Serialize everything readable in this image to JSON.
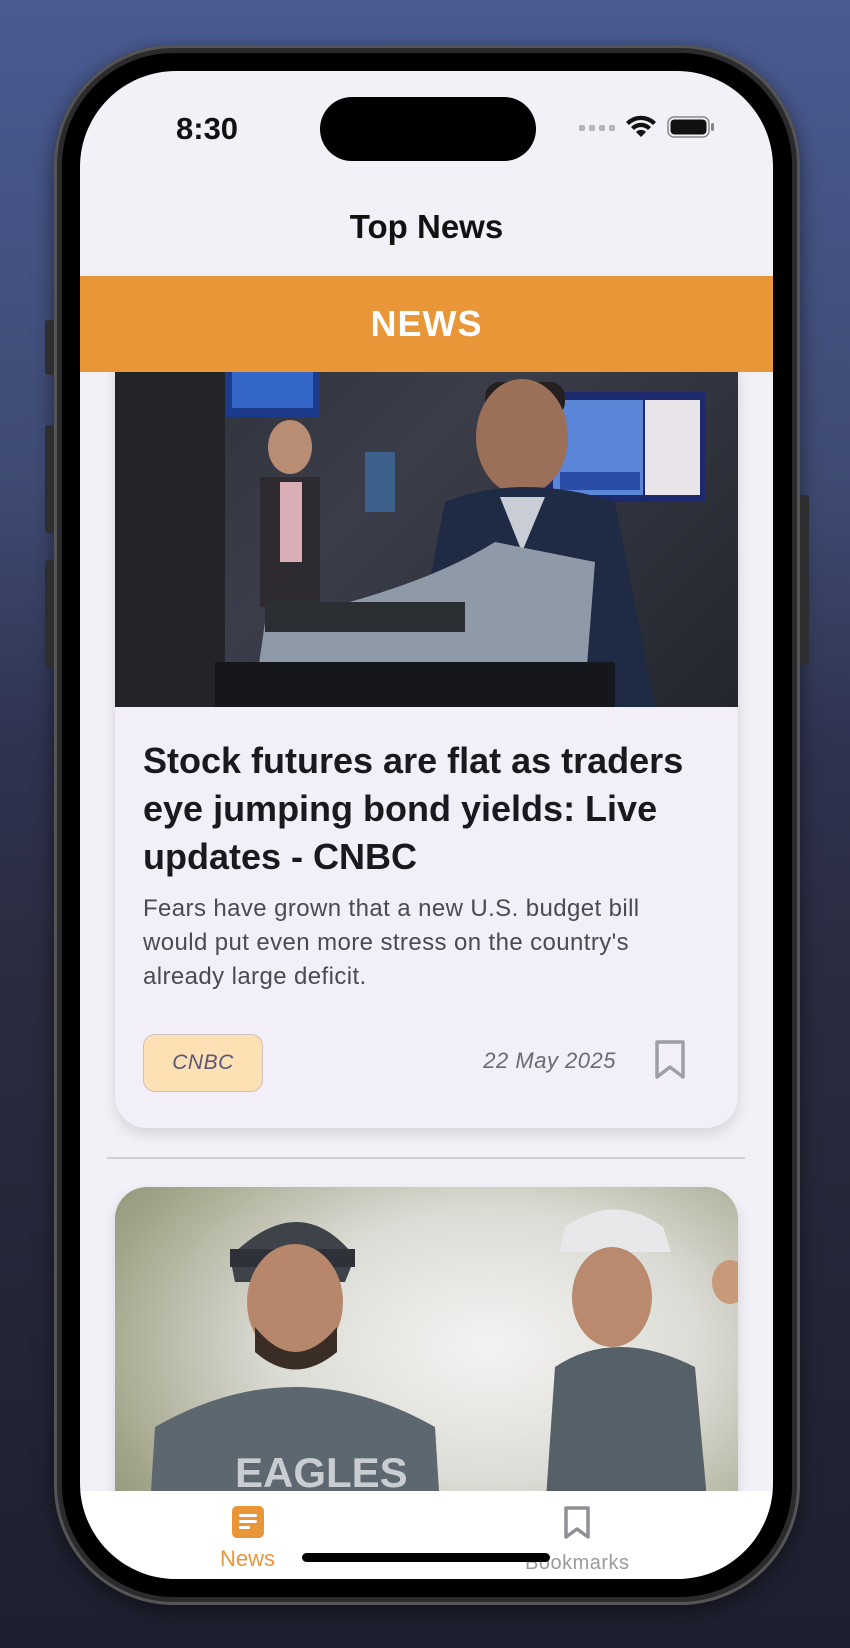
{
  "status_bar": {
    "time": "8:30"
  },
  "header": {
    "title": "Top News"
  },
  "banner": {
    "label": "NEWS"
  },
  "articles": [
    {
      "title": "Stock futures are flat as traders eye jumping bond yields: Live updates - CNBC",
      "description": "Fears have grown that a new U.S. budget bill would put even more stress on the country's already large deficit.",
      "source": "CNBC",
      "date": "22 May 2025",
      "image_icon": "trading-floor-photo",
      "bookmark_icon": "bookmark-outline-icon"
    },
    {
      "image_icon": "eagles-coaches-photo"
    }
  ],
  "tabbar": {
    "tabs": [
      {
        "label": "News",
        "icon": "news-doc-icon",
        "active": true
      },
      {
        "label": "Bookmarks",
        "icon": "bookmark-icon",
        "active": false
      }
    ]
  },
  "colors": {
    "accent": "#e89638",
    "card_background": "#f2eff8",
    "badge_background": "#fde0b3",
    "inactive_tab": "#9a9aa0"
  }
}
